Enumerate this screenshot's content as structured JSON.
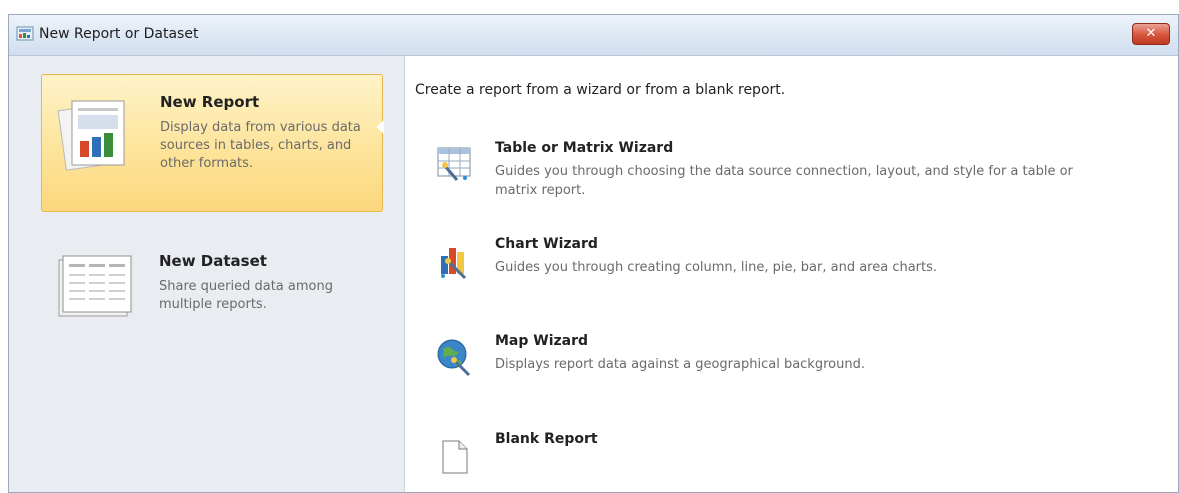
{
  "window": {
    "title": "New Report or Dataset",
    "close_symbol": "✕"
  },
  "left_pane": {
    "items": [
      {
        "title": "New Report",
        "description": "Display data from various data sources in tables, charts, and other formats.",
        "selected": true,
        "icon": "report-icon"
      },
      {
        "title": "New Dataset",
        "description": "Share queried data among multiple reports.",
        "selected": false,
        "icon": "dataset-icon"
      }
    ]
  },
  "right_pane": {
    "intro": "Create a report from a wizard or from a blank report.",
    "options": [
      {
        "title": "Table or Matrix Wizard",
        "description": "Guides you through choosing the data source connection, layout, and style for a table or matrix report.",
        "icon": "table-wizard-icon"
      },
      {
        "title": "Chart Wizard",
        "description": "Guides you through creating column, line, pie, bar, and area charts.",
        "icon": "chart-wizard-icon"
      },
      {
        "title": "Map Wizard",
        "description": "Displays report data against a geographical background.",
        "icon": "map-wizard-icon"
      },
      {
        "title": "Blank Report",
        "description": "",
        "icon": "blank-report-icon"
      }
    ]
  },
  "colors": {
    "selection_fill": "#fde49b",
    "selection_border": "#e6b94f",
    "left_pane_bg": "#e9edf2",
    "close_button": "#d6543d"
  }
}
